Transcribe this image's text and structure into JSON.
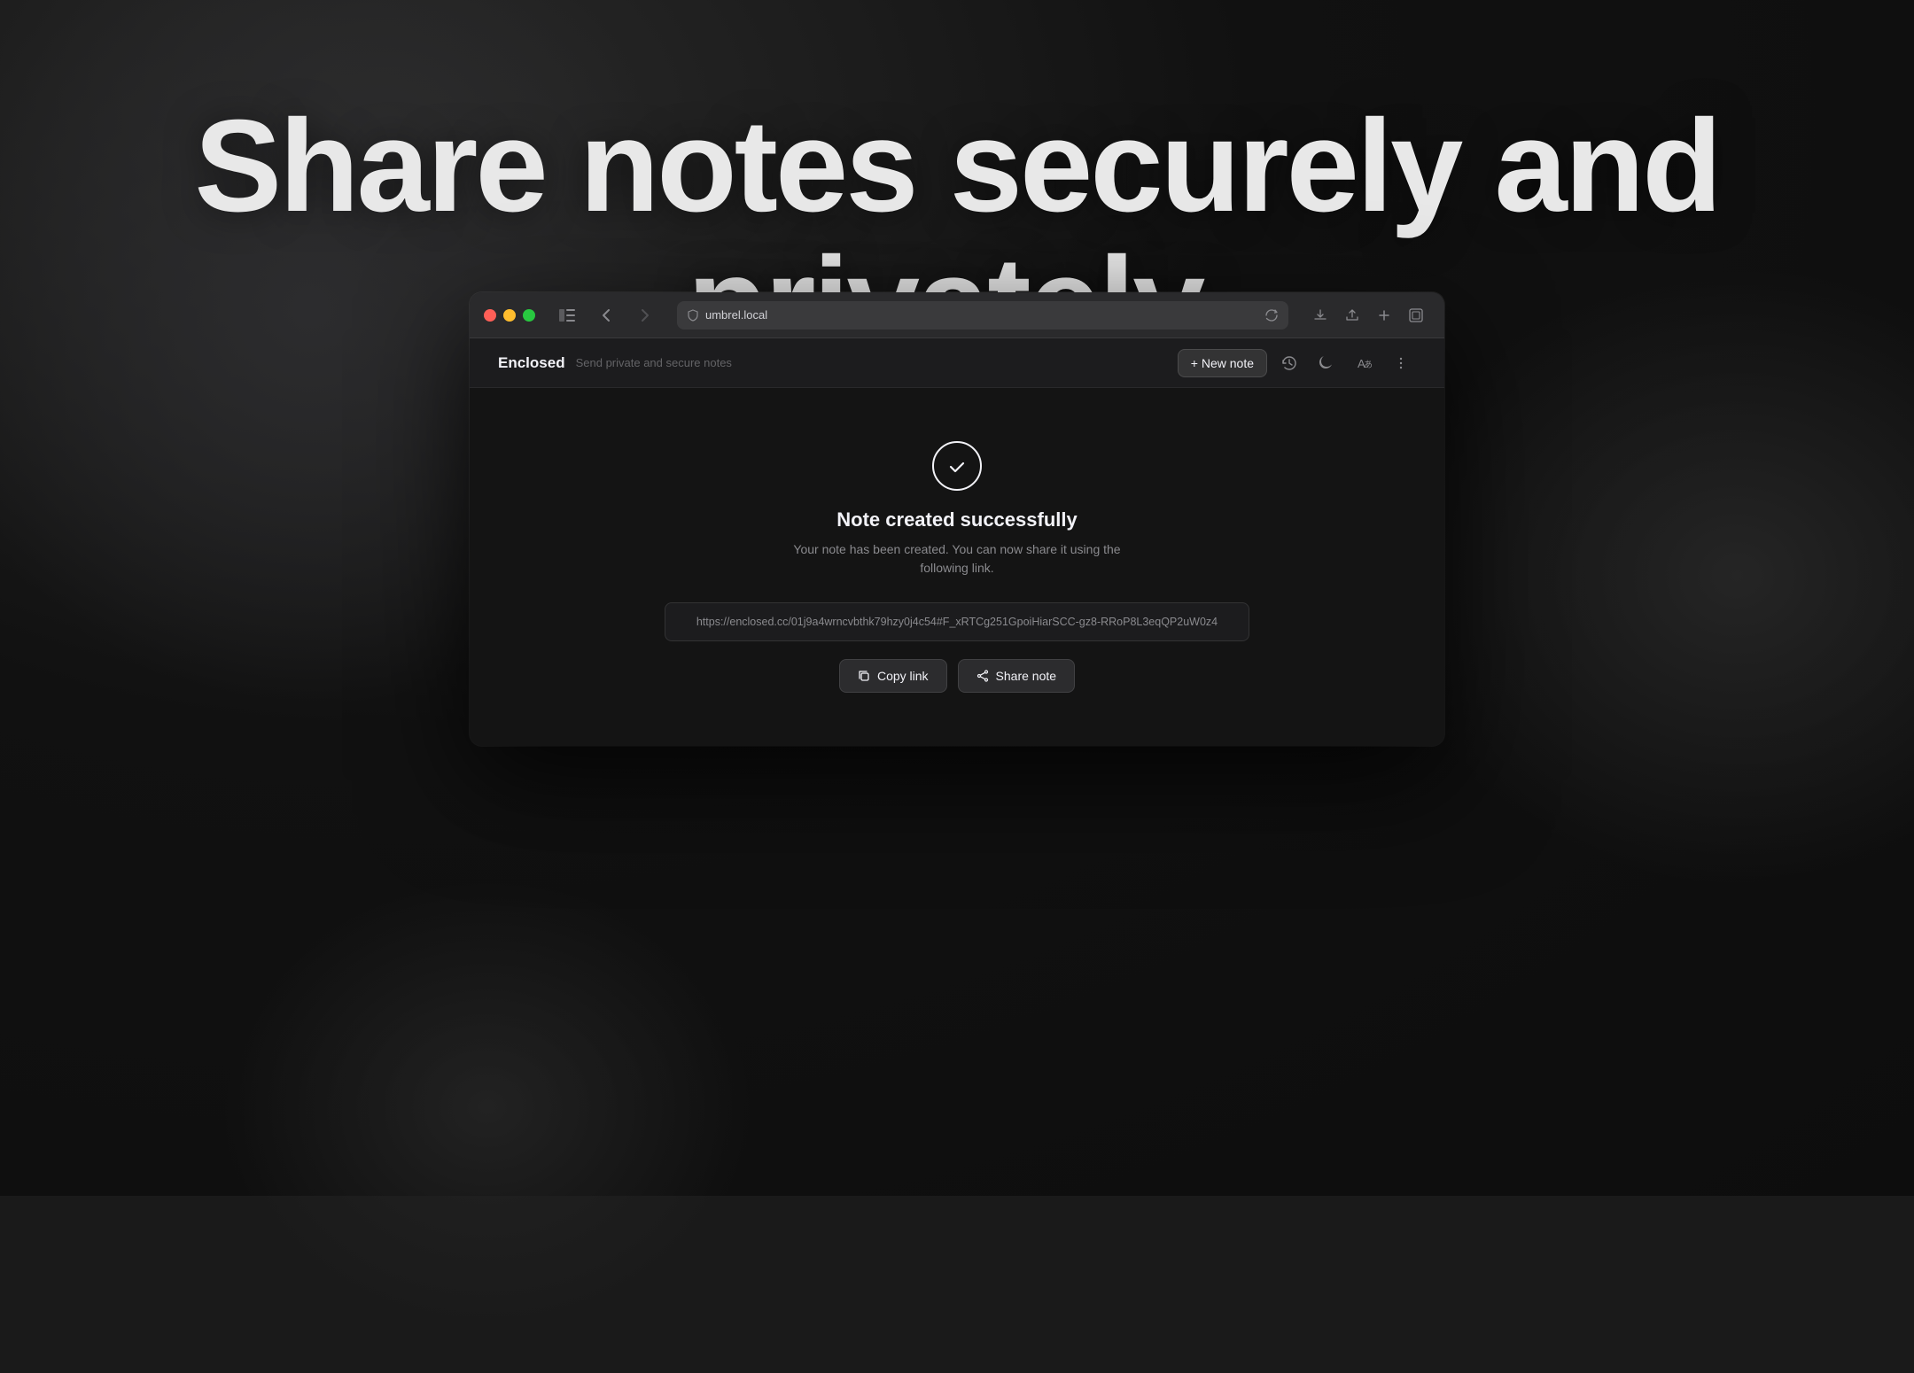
{
  "background": {
    "color": "#1a1a1a"
  },
  "headline": {
    "text": "Share notes securely and privately."
  },
  "browser": {
    "url": "umbrel.local",
    "traffic_lights": {
      "red": "#ff5f57",
      "yellow": "#ffbd2e",
      "green": "#28c840"
    }
  },
  "app": {
    "name": "Enclosed",
    "tagline": "Send private and secure notes",
    "new_note_button": "+ New note",
    "success": {
      "title": "Note created successfully",
      "description_line1": "Your note has been created. You can now share it using the",
      "description_line2": "following link.",
      "link": "https://enclosed.cc/01j9a4wrncvbthk79hzy0j4c54#F_xRTCg251GpoiHiarSCC-gz8-RRoP8L3eqQP2uW0z4",
      "copy_button": "Copy link",
      "share_button": "Share note"
    }
  }
}
